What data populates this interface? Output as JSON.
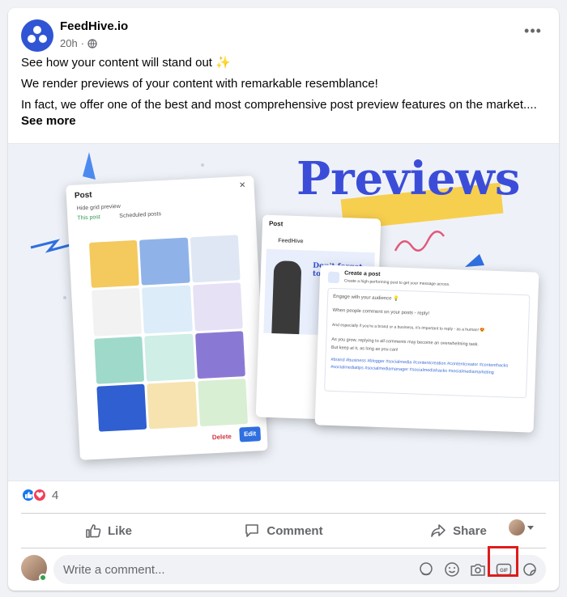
{
  "post": {
    "author": "FeedHive.io",
    "time": "20h",
    "lines": [
      "See how your content will stand out ✨",
      "We render previews of your content with remarkable resemblance!",
      "In fact, we offer one of the best and most comprehensive post preview features on the market...."
    ],
    "see_more": "See more"
  },
  "media": {
    "title": "Previews",
    "post_panel": {
      "title": "Post",
      "hide_grid": "Hide grid preview",
      "this_post": "This post",
      "scheduled": "Scheduled posts",
      "delete": "Delete",
      "edit": "Edit"
    },
    "ig_panel": {
      "title": "Post",
      "account": "FeedHive",
      "caption": "Don't forget to be a human"
    },
    "create_panel": {
      "title": "Create a post",
      "subtitle": "Create a high-performing post to get your message across.",
      "l1": "Engage with your audience 💡",
      "l2": "When people comment on your posts - reply!",
      "l3": "And especially if you're a brand or a business, it's important to reply - as a human! 😍",
      "l4": "As you grow, replying to all comments may become an overwhelming task.",
      "l5": "But keep at it, as long as you can!",
      "tags": "#brand #business #blogger #socialmedia #contentcreation #contentcreator #contenthacks #socialmediatips #socialmediamanager #socialmediahacks #socialmediamarketing"
    }
  },
  "reactions": {
    "count": "4"
  },
  "actions": {
    "like": "Like",
    "comment": "Comment",
    "share": "Share"
  },
  "comment": {
    "placeholder": "Write a comment..."
  },
  "colors": {
    "brand": "#2f55d4",
    "like": "#1877f2",
    "love": "#f33e58",
    "highlight": "#e01b1b"
  }
}
